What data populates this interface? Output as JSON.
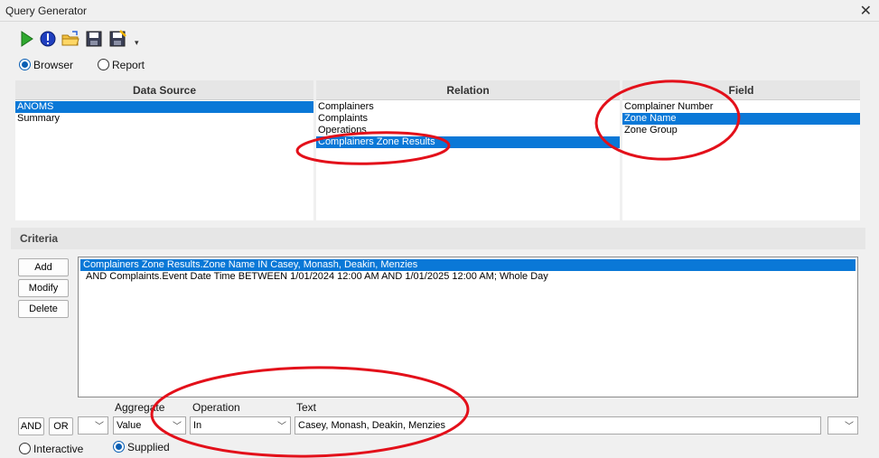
{
  "window": {
    "title": "Query Generator",
    "close_glyph": "✕"
  },
  "toolbar": {
    "overflow_glyph": "▾"
  },
  "mode": {
    "browser": "Browser",
    "report": "Report",
    "selected": "Browser"
  },
  "data_source": {
    "header": "Data Source",
    "items": [
      "ANOMS",
      "Summary"
    ],
    "selected_index": 0
  },
  "relation": {
    "header": "Relation",
    "items": [
      "Complainers",
      "Complaints",
      "Operations",
      "Complainers Zone Results"
    ],
    "selected_index": 3
  },
  "field": {
    "header": "Field",
    "items": [
      "Complainer Number",
      "Zone Name",
      "Zone Group"
    ],
    "selected_index": 1
  },
  "criteria": {
    "title": "Criteria",
    "buttons": {
      "add": "Add",
      "modify": "Modify",
      "delete": "Delete"
    },
    "rows": [
      "Complainers Zone Results.Zone Name IN Casey, Monash, Deakin, Menzies",
      "AND Complaints.Event Date Time BETWEEN 1/01/2024 12:00 AM AND 1/01/2025 12:00 AM; Whole Day"
    ],
    "selected_index": 0
  },
  "bottom": {
    "and_label": "AND",
    "or_label": "OR",
    "aggregate_label": "Aggregate",
    "aggregate_value": "Value",
    "operation_label": "Operation",
    "operation_value": "In",
    "text_label": "Text",
    "text_value": "Casey, Monash, Deakin, Menzies",
    "interactive_label": "Interactive",
    "supplied_label": "Supplied",
    "chevron": "﹀"
  },
  "colors": {
    "selection": "#0a78d7",
    "annotation": "#e3101a",
    "radio": "#0a5fb4"
  }
}
